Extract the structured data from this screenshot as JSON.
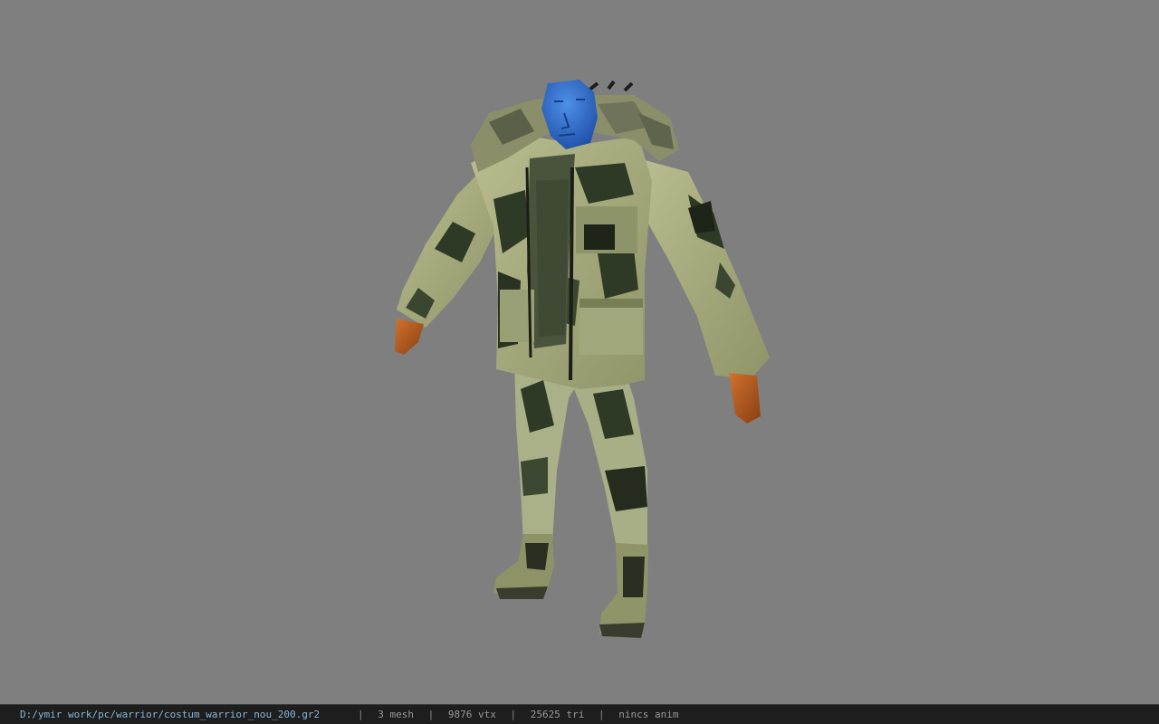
{
  "viewer": {
    "background_color": "#7f7f7f",
    "model_name": "costum_warrior_nou_200"
  },
  "statusbar": {
    "file_path": "D:/ymir work/pc/warrior/costum_warrior_nou_200.gr2",
    "separator": "|",
    "mesh_count": "3 mesh",
    "vertex_count": "9876 vtx",
    "triangle_count": "25625 tri",
    "animation": "nincs anim",
    "path_color": "#86b7d6",
    "text_color": "#9a9a9a"
  }
}
